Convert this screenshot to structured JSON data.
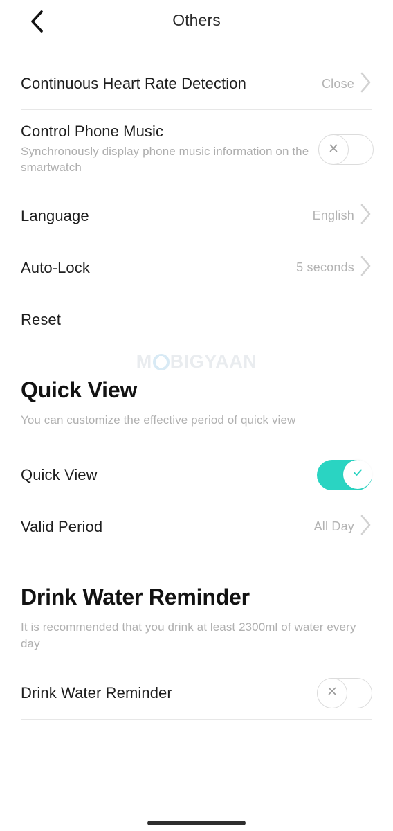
{
  "header": {
    "title": "Others",
    "back_icon": "chevron-left-icon"
  },
  "watermark": {
    "text_before": "M",
    "text_after": "BIGYAAN",
    "full_text": "MOBIGYAAN"
  },
  "settings_rows": [
    {
      "label": "Continuous Heart Rate Detection",
      "value": "Close",
      "chevron_icon": "chevron-right-icon"
    },
    {
      "label": "Language",
      "value": "English",
      "chevron_icon": "chevron-right-icon"
    },
    {
      "label": "Auto-Lock",
      "value": "5 seconds",
      "chevron_icon": "chevron-right-icon"
    },
    {
      "label": "Reset",
      "value": "",
      "chevron_icon": ""
    }
  ],
  "control_phone_music": {
    "label": "Control Phone Music",
    "description": "Synchronously display phone music information on the smartwatch",
    "toggle_state": "off",
    "toggle_icon": "close-x-icon"
  },
  "quick_view": {
    "heading": "Quick View",
    "description": "You can customize the effective period of quick view",
    "toggle_row_label": "Quick View",
    "toggle_state": "on",
    "toggle_icon": "check-icon",
    "valid_period_label": "Valid Period",
    "valid_period_value": "All Day",
    "chevron_icon": "chevron-right-icon"
  },
  "drink_water_reminder": {
    "heading": "Drink Water Reminder",
    "description": "It is recommended that you drink at least 2300ml of water every day",
    "toggle_row_label": "Drink Water Reminder",
    "toggle_state": "off",
    "toggle_icon": "close-x-icon"
  },
  "colors": {
    "accent_teal": "#2ad4c2",
    "toggle_off_border": "#dcdcdc",
    "separator": "#e7e7e7",
    "muted_text": "#b3b3b3",
    "primary_text": "#1e1e1e",
    "watermark_text": "#e9ecef",
    "watermark_ring": "#d8eaf5",
    "home_indicator": "#2e2e2e"
  }
}
